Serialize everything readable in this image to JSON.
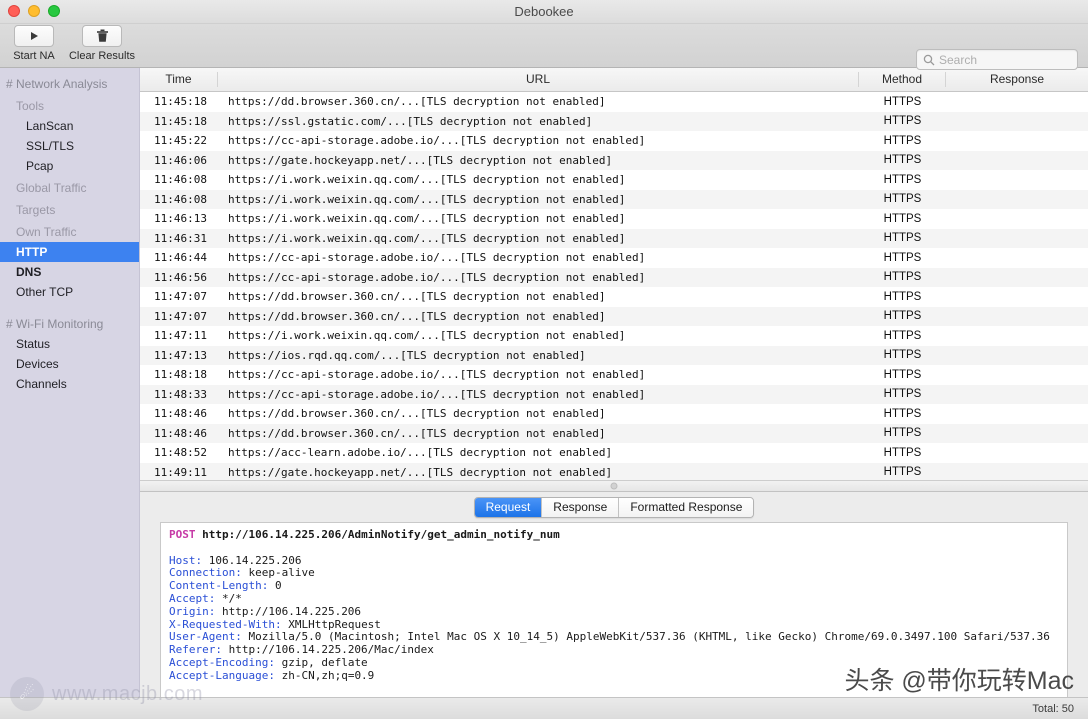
{
  "window": {
    "title": "Debookee",
    "traffic_lights": [
      "close",
      "minimize",
      "maximize"
    ]
  },
  "toolbar": {
    "buttons": [
      {
        "icon": "play-icon",
        "label": "Start NA"
      },
      {
        "icon": "trash-icon",
        "label": "Clear Results"
      }
    ],
    "search": {
      "icon": "search-icon",
      "placeholder": "Search",
      "value": ""
    }
  },
  "sidebar": {
    "sections": [
      {
        "header": "# Network Analysis",
        "groups": [
          {
            "label": "Tools",
            "items": [
              {
                "label": "LanScan",
                "selected": false,
                "bold": false
              },
              {
                "label": "SSL/TLS",
                "selected": false,
                "bold": false
              },
              {
                "label": "Pcap",
                "selected": false,
                "bold": false
              }
            ]
          },
          {
            "label": "Global Traffic",
            "items": []
          },
          {
            "label": "Targets",
            "items": []
          },
          {
            "label": "Own Traffic",
            "items": [
              {
                "label": "HTTP",
                "selected": true,
                "bold": true
              },
              {
                "label": "DNS",
                "selected": false,
                "bold": true
              },
              {
                "label": "Other TCP",
                "selected": false,
                "bold": false
              }
            ]
          }
        ]
      },
      {
        "header": "# Wi-Fi Monitoring",
        "groups": [
          {
            "label": "",
            "items": [
              {
                "label": "Status",
                "selected": false,
                "bold": false,
                "level": 1
              },
              {
                "label": "Devices",
                "selected": false,
                "bold": false,
                "level": 1
              },
              {
                "label": "Channels",
                "selected": false,
                "bold": false,
                "level": 1
              }
            ]
          }
        ]
      }
    ]
  },
  "table": {
    "columns": [
      "Time",
      "URL",
      "Method",
      "Response"
    ],
    "rows": [
      {
        "time": "11:45:18",
        "url": "https://dd.browser.360.cn/...[TLS decryption not enabled]",
        "method": "HTTPS",
        "response": ""
      },
      {
        "time": "11:45:18",
        "url": "https://ssl.gstatic.com/...[TLS decryption not enabled]",
        "method": "HTTPS",
        "response": ""
      },
      {
        "time": "11:45:22",
        "url": "https://cc-api-storage.adobe.io/...[TLS decryption not enabled]",
        "method": "HTTPS",
        "response": ""
      },
      {
        "time": "11:46:06",
        "url": "https://gate.hockeyapp.net/...[TLS decryption not enabled]",
        "method": "HTTPS",
        "response": ""
      },
      {
        "time": "11:46:08",
        "url": "https://i.work.weixin.qq.com/...[TLS decryption not enabled]",
        "method": "HTTPS",
        "response": ""
      },
      {
        "time": "11:46:08",
        "url": "https://i.work.weixin.qq.com/...[TLS decryption not enabled]",
        "method": "HTTPS",
        "response": ""
      },
      {
        "time": "11:46:13",
        "url": "https://i.work.weixin.qq.com/...[TLS decryption not enabled]",
        "method": "HTTPS",
        "response": ""
      },
      {
        "time": "11:46:31",
        "url": "https://i.work.weixin.qq.com/...[TLS decryption not enabled]",
        "method": "HTTPS",
        "response": ""
      },
      {
        "time": "11:46:44",
        "url": "https://cc-api-storage.adobe.io/...[TLS decryption not enabled]",
        "method": "HTTPS",
        "response": ""
      },
      {
        "time": "11:46:56",
        "url": "https://cc-api-storage.adobe.io/...[TLS decryption not enabled]",
        "method": "HTTPS",
        "response": ""
      },
      {
        "time": "11:47:07",
        "url": "https://dd.browser.360.cn/...[TLS decryption not enabled]",
        "method": "HTTPS",
        "response": ""
      },
      {
        "time": "11:47:07",
        "url": "https://dd.browser.360.cn/...[TLS decryption not enabled]",
        "method": "HTTPS",
        "response": ""
      },
      {
        "time": "11:47:11",
        "url": "https://i.work.weixin.qq.com/...[TLS decryption not enabled]",
        "method": "HTTPS",
        "response": ""
      },
      {
        "time": "11:47:13",
        "url": "https://ios.rqd.qq.com/...[TLS decryption not enabled]",
        "method": "HTTPS",
        "response": ""
      },
      {
        "time": "11:48:18",
        "url": "https://cc-api-storage.adobe.io/...[TLS decryption not enabled]",
        "method": "HTTPS",
        "response": ""
      },
      {
        "time": "11:48:33",
        "url": "https://cc-api-storage.adobe.io/...[TLS decryption not enabled]",
        "method": "HTTPS",
        "response": ""
      },
      {
        "time": "11:48:46",
        "url": "https://dd.browser.360.cn/...[TLS decryption not enabled]",
        "method": "HTTPS",
        "response": ""
      },
      {
        "time": "11:48:46",
        "url": "https://dd.browser.360.cn/...[TLS decryption not enabled]",
        "method": "HTTPS",
        "response": ""
      },
      {
        "time": "11:48:52",
        "url": "https://acc-learn.adobe.io/...[TLS decryption not enabled]",
        "method": "HTTPS",
        "response": ""
      },
      {
        "time": "11:49:11",
        "url": "https://gate.hockeyapp.net/...[TLS decryption not enabled]",
        "method": "HTTPS",
        "response": ""
      }
    ]
  },
  "detail": {
    "tabs": [
      {
        "label": "Request",
        "active": true
      },
      {
        "label": "Response",
        "active": false
      },
      {
        "label": "Formatted Response",
        "active": false
      }
    ],
    "request": {
      "method": "POST",
      "url": "http://106.14.225.206/AdminNotify/get_admin_notify_num",
      "headers": [
        {
          "name": "Host",
          "value": "106.14.225.206"
        },
        {
          "name": "Connection",
          "value": "keep-alive"
        },
        {
          "name": "Content-Length",
          "value": "0"
        },
        {
          "name": "Accept",
          "value": "*/*"
        },
        {
          "name": "Origin",
          "value": "http://106.14.225.206"
        },
        {
          "name": "X-Requested-With",
          "value": "XMLHttpRequest"
        },
        {
          "name": "User-Agent",
          "value": "Mozilla/5.0 (Macintosh; Intel Mac OS X 10_14_5) AppleWebKit/537.36 (KHTML, like Gecko) Chrome/69.0.3497.100 Safari/537.36"
        },
        {
          "name": "Referer",
          "value": "http://106.14.225.206/Mac/index"
        },
        {
          "name": "Accept-Encoding",
          "value": "gzip, deflate"
        },
        {
          "name": "Accept-Language",
          "value": "zh-CN,zh;q=0.9"
        }
      ]
    }
  },
  "statusbar": {
    "total_label": "Total: 50"
  },
  "watermarks": {
    "left_text": "www.macjb.com",
    "right_text": "头条 @带你玩转Mac"
  },
  "colors": {
    "accent_blue": "#3d82f0",
    "sidebar_bg": "#d7d5e4",
    "tab_active": "#1c73e8"
  }
}
